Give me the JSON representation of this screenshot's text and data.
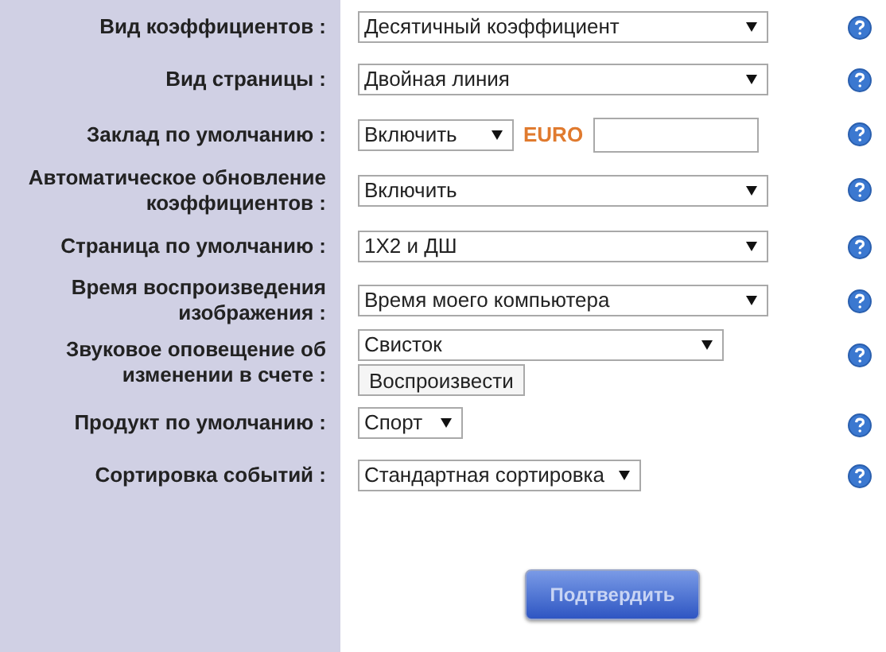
{
  "settings": [
    {
      "kind": "select",
      "label": "Вид коэффициентов :",
      "value": "Десятичный коэффициент"
    },
    {
      "kind": "select",
      "label": "Вид страницы :",
      "value": "Двойная линия"
    },
    {
      "kind": "amount",
      "label": "Заклад по умолчанию :",
      "value": "Включить",
      "currency": "EURO"
    },
    {
      "kind": "select",
      "label": "Автоматическое обновление коэффициентов :",
      "value": "Включить"
    },
    {
      "kind": "select",
      "label": "Страница по умолчанию :",
      "value": "1X2 и ДШ"
    },
    {
      "kind": "select",
      "label": "Время воспроизведения изображения :",
      "value": "Время моего компьютера"
    },
    {
      "kind": "sound",
      "label": "Звуковое оповещение об изменении в счете :",
      "value": "Свисток",
      "button": "Воспроизвести"
    },
    {
      "kind": "select",
      "label": "Продукт по умолчанию :",
      "value": "Спорт"
    },
    {
      "kind": "select",
      "label": "Сортировка событий :",
      "value": "Стандартная сортировка"
    }
  ],
  "submit": "Подтвердить"
}
